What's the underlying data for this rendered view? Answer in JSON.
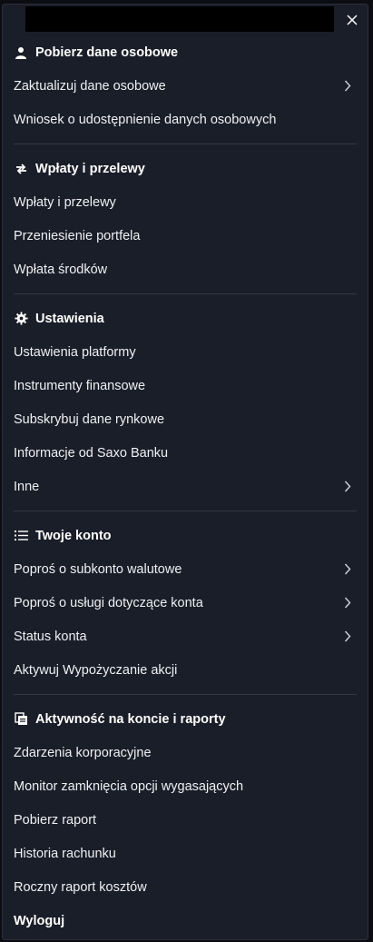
{
  "sections": [
    {
      "title": "Pobierz dane osobowe",
      "icon": "person-icon",
      "items": [
        {
          "label": "Zaktualizuj dane osobowe",
          "chevron": true
        },
        {
          "label": "Wniosek o udostępnienie danych osobowych",
          "chevron": false
        }
      ]
    },
    {
      "title": "Wpłaty i przelewy",
      "icon": "transfer-arrows-icon",
      "items": [
        {
          "label": "Wpłaty i przelewy",
          "chevron": false
        },
        {
          "label": "Przeniesienie portfela",
          "chevron": false
        },
        {
          "label": "Wpłata środków",
          "chevron": false
        }
      ]
    },
    {
      "title": "Ustawienia",
      "icon": "gear-icon",
      "items": [
        {
          "label": "Ustawienia platformy",
          "chevron": false
        },
        {
          "label": "Instrumenty finansowe",
          "chevron": false
        },
        {
          "label": "Subskrybuj dane rynkowe",
          "chevron": false
        },
        {
          "label": "Informacje od Saxo Banku",
          "chevron": false
        },
        {
          "label": "Inne",
          "chevron": true
        }
      ]
    },
    {
      "title": "Twoje konto",
      "icon": "list-icon",
      "items": [
        {
          "label": "Poproś o subkonto walutowe",
          "chevron": true
        },
        {
          "label": "Poproś o usługi dotyczące konta",
          "chevron": true
        },
        {
          "label": "Status konta",
          "chevron": true
        },
        {
          "label": "Aktywuj Wypożyczanie akcji",
          "chevron": false
        }
      ]
    },
    {
      "title": "Aktywność na koncie i raporty",
      "icon": "reports-icon",
      "items": [
        {
          "label": "Zdarzenia korporacyjne",
          "chevron": false
        },
        {
          "label": "Monitor zamknięcia opcji wygasających",
          "chevron": false
        },
        {
          "label": "Pobierz raport",
          "chevron": false
        },
        {
          "label": "Historia rachunku",
          "chevron": false
        },
        {
          "label": "Roczny raport kosztów",
          "chevron": false
        }
      ]
    }
  ],
  "logout_label": "Wyloguj",
  "colors": {
    "panel": "#1a1e28",
    "divider": "#333846",
    "text": "#eef0f3"
  }
}
